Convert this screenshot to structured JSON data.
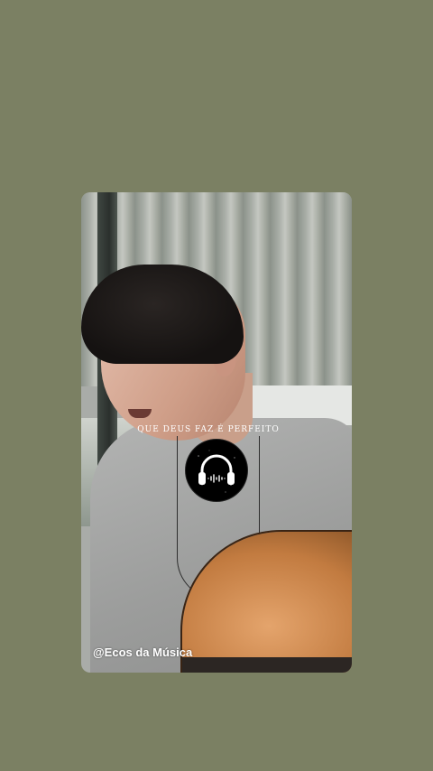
{
  "story": {
    "lyric_caption": "que Deus faz é perfeito",
    "music_badge_icon": "headphones-icon",
    "handle": "@Ecos da Música"
  },
  "colors": {
    "page_background": "#7b8063",
    "badge_background": "#000000",
    "text": "#ffffff"
  }
}
